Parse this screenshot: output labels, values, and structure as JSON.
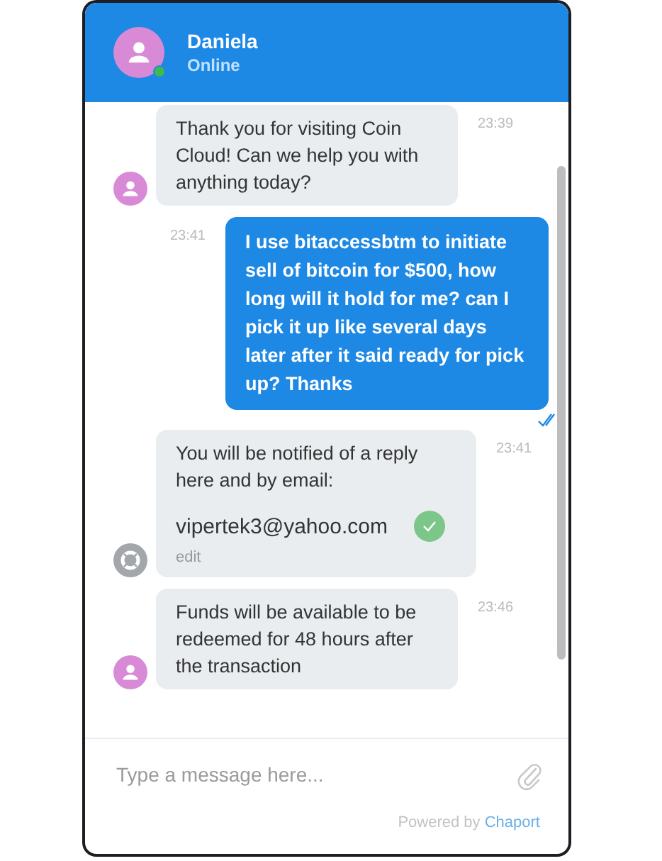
{
  "header": {
    "name": "Daniela",
    "status": "Online",
    "online": true
  },
  "messages": [
    {
      "kind": "agent",
      "text": "Thank you for visiting Coin Cloud! Can we help you with anything today?",
      "time": "23:39"
    },
    {
      "kind": "visitor",
      "text": "I use bitaccessbtm to initiate sell of bitcoin for $500, how long will it hold for me? can I pick it up like several days later after it said ready for pick up? Thanks",
      "time": "23:41",
      "read": true
    },
    {
      "kind": "bot",
      "text": "You will be notified of a reply here and by email:",
      "email": "vipertek3@yahoo.com",
      "confirmed": true,
      "action": "edit",
      "time": "23:41"
    },
    {
      "kind": "agent",
      "text": "Funds will be available to be redeemed for 48 hours after the transaction",
      "time": "23:46"
    }
  ],
  "composer": {
    "placeholder": "Type a message here..."
  },
  "footer": {
    "text": "Powered by",
    "brand": "Chaport"
  }
}
